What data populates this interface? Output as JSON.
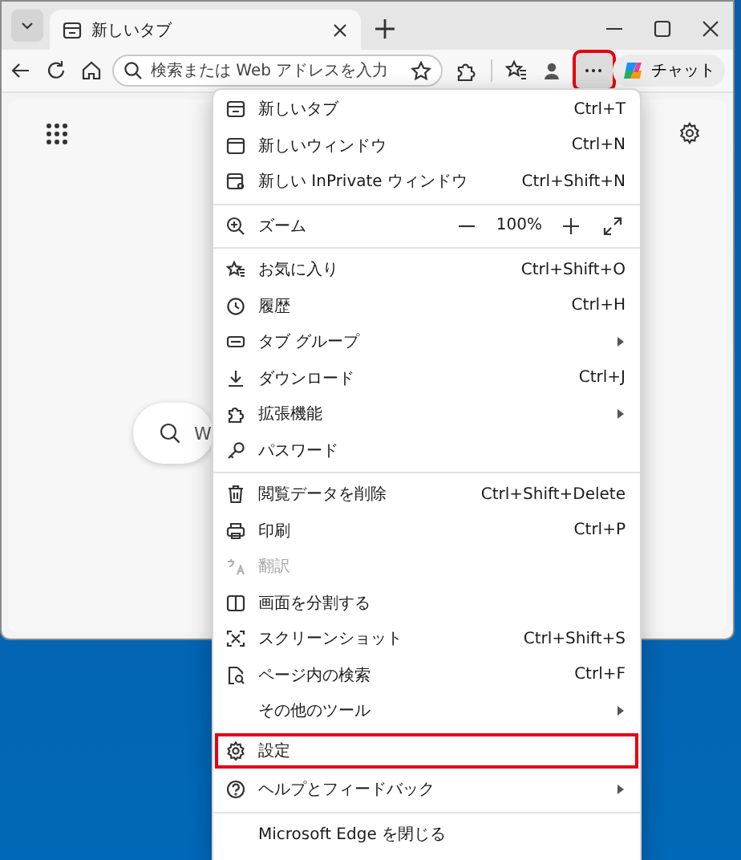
{
  "tabs": [
    {
      "title": "新しいタブ",
      "selected": true
    }
  ],
  "address_bar": {
    "placeholder": "検索または Web アドレスを入力"
  },
  "toolbar": {
    "more_button": {
      "highlighted": true
    },
    "chat_button": {
      "label": "チャット"
    }
  },
  "page": {
    "search": {
      "placeholder": "W"
    }
  },
  "menu": {
    "items": [
      {
        "kind": "item",
        "label": "新しいタブ",
        "shortcut": "Ctrl+T",
        "has_submenu": false,
        "disabled": false,
        "highlighted": false
      },
      {
        "kind": "item",
        "label": "新しいウィンドウ",
        "shortcut": "Ctrl+N",
        "has_submenu": false,
        "disabled": false,
        "highlighted": false
      },
      {
        "kind": "item",
        "label": "新しい InPrivate ウィンドウ",
        "shortcut": "Ctrl+Shift+N",
        "has_submenu": false,
        "disabled": false,
        "highlighted": false
      },
      {
        "kind": "separator"
      },
      {
        "kind": "zoom",
        "label": "ズーム",
        "value": "100%"
      },
      {
        "kind": "separator"
      },
      {
        "kind": "item",
        "label": "お気に入り",
        "shortcut": "Ctrl+Shift+O",
        "has_submenu": false,
        "disabled": false,
        "highlighted": false
      },
      {
        "kind": "item",
        "label": "履歴",
        "shortcut": "Ctrl+H",
        "has_submenu": false,
        "disabled": false,
        "highlighted": false
      },
      {
        "kind": "item",
        "label": "タブ グループ",
        "has_submenu": true,
        "disabled": false,
        "highlighted": false
      },
      {
        "kind": "item",
        "label": "ダウンロード",
        "shortcut": "Ctrl+J",
        "has_submenu": false,
        "disabled": false,
        "highlighted": false
      },
      {
        "kind": "item",
        "label": "拡張機能",
        "has_submenu": true,
        "disabled": false,
        "highlighted": false
      },
      {
        "kind": "item",
        "label": "パスワード",
        "has_submenu": false,
        "disabled": false,
        "highlighted": false
      },
      {
        "kind": "separator"
      },
      {
        "kind": "item",
        "label": "閲覧データを削除",
        "shortcut": "Ctrl+Shift+Delete",
        "has_submenu": false,
        "disabled": false,
        "highlighted": false
      },
      {
        "kind": "item",
        "label": "印刷",
        "shortcut": "Ctrl+P",
        "has_submenu": false,
        "disabled": false,
        "highlighted": false
      },
      {
        "kind": "item",
        "label": "翻訳",
        "has_submenu": false,
        "disabled": true,
        "highlighted": false
      },
      {
        "kind": "item",
        "label": "画面を分割する",
        "has_submenu": false,
        "disabled": false,
        "highlighted": false
      },
      {
        "kind": "item",
        "label": "スクリーンショット",
        "shortcut": "Ctrl+Shift+S",
        "has_submenu": false,
        "disabled": false,
        "highlighted": false
      },
      {
        "kind": "item",
        "label": "ページ内の検索",
        "shortcut": "Ctrl+F",
        "has_submenu": false,
        "disabled": false,
        "highlighted": false
      },
      {
        "kind": "item",
        "label": "その他のツール",
        "has_submenu": true,
        "disabled": false,
        "highlighted": false
      },
      {
        "kind": "item",
        "label": "設定",
        "has_submenu": false,
        "disabled": false,
        "highlighted": true
      },
      {
        "kind": "item",
        "label": "ヘルプとフィードバック",
        "has_submenu": true,
        "disabled": false,
        "highlighted": false
      },
      {
        "kind": "separator"
      },
      {
        "kind": "item",
        "label": "Microsoft Edge を閉じる",
        "has_submenu": false,
        "disabled": false,
        "highlighted": false
      }
    ]
  }
}
